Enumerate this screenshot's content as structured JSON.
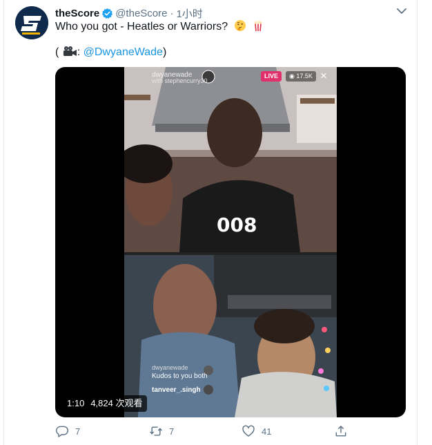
{
  "tweet": {
    "author_name": "theScore",
    "author_handle": "@theScore",
    "separator": "·",
    "timestamp": "1小时",
    "text": "Who you got - Heatles or Warriors?",
    "credit_open": "(",
    "credit_mention": "@DwyaneWade",
    "credit_close": ")",
    "credit_separator": ":"
  },
  "video": {
    "duration": "1:10",
    "views": "4,824 次观看",
    "live_overlay": {
      "username": "dwyanewade",
      "subtitle": "with stephencurry30",
      "live_label": "LIVE",
      "viewer_count": "17.5K",
      "close_glyph": "×"
    },
    "comments": [
      {
        "user": "dwyanewade",
        "text": "Kudos to you both"
      },
      {
        "user": "tanveer_.singh",
        "text": ""
      }
    ]
  },
  "actions": {
    "reply_count": "7",
    "retweet_count": "7",
    "like_count": "41"
  },
  "icons": {
    "avatar": "thescore-logo",
    "verified": "verified-badge-icon",
    "caret": "chevron-down-icon",
    "reply": "reply-icon",
    "retweet": "retweet-icon",
    "like": "heart-icon",
    "share": "share-icon"
  },
  "colors": {
    "link": "#1b95e0",
    "secondary_text": "#5b7083",
    "verified": "#1da1f2",
    "live": "#e1306c"
  }
}
